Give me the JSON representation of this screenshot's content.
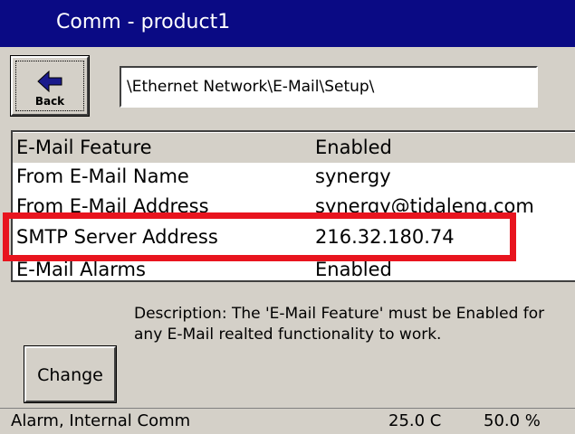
{
  "window": {
    "title": "Comm - product1"
  },
  "toolbar": {
    "back_label": "Back",
    "back_icon": "arrow-left-icon",
    "path": "\\Ethernet Network\\E-Mail\\Setup\\"
  },
  "settings": {
    "rows": [
      {
        "name": "E-Mail Feature",
        "value": "Enabled",
        "selected": true
      },
      {
        "name": "From E-Mail Name",
        "value": "synergy",
        "selected": false
      },
      {
        "name": "From E-Mail Address",
        "value": "synergy@tidaleng.com",
        "selected": false
      },
      {
        "name": "SMTP Server Address",
        "value": "216.32.180.74",
        "selected": false
      },
      {
        "name": "E-Mail Alarms",
        "value": "Enabled",
        "selected": false
      }
    ]
  },
  "description": {
    "text": "Description:  The 'E-Mail Feature' must be Enabled for any E-Mail realted functionality to work."
  },
  "actions": {
    "change_label": "Change"
  },
  "status": {
    "alarm": "Alarm, Internal Comm",
    "temperature": "25.0 C",
    "humidity": "50.0 %"
  },
  "colors": {
    "titlebar": "#0a0a84",
    "highlight": "#e8141e",
    "panel": "#d4d0c8"
  }
}
